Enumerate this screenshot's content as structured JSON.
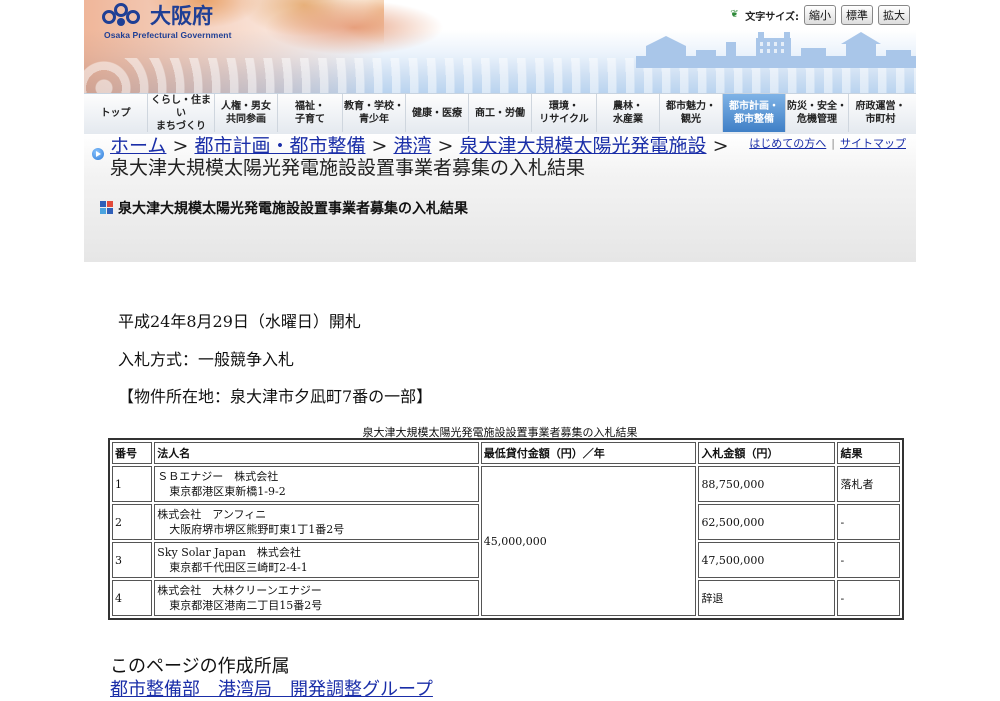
{
  "header": {
    "logo_jp": "大阪府",
    "logo_en": "Osaka Prefectural Government",
    "text_size_label": "文字サイズ:",
    "text_size_buttons": [
      "縮小",
      "標準",
      "拡大"
    ]
  },
  "nav": {
    "items": [
      {
        "label": "トップ",
        "active": false
      },
      {
        "label": "くらし・住まい\nまちづくり",
        "active": false
      },
      {
        "label": "人権・男女\n共同参画",
        "active": false
      },
      {
        "label": "福祉・\n子育て",
        "active": false
      },
      {
        "label": "教育・学校・\n青少年",
        "active": false
      },
      {
        "label": "健康・医療",
        "active": false
      },
      {
        "label": "商工・労働",
        "active": false
      },
      {
        "label": "環境・\nリサイクル",
        "active": false
      },
      {
        "label": "農林・\n水産業",
        "active": false
      },
      {
        "label": "都市魅力・\n観光",
        "active": false
      },
      {
        "label": "都市計画・\n都市整備",
        "active": true
      },
      {
        "label": "防災・安全・\n危機管理",
        "active": false
      },
      {
        "label": "府政運営・\n市町村",
        "active": false
      }
    ]
  },
  "breadcrumb": {
    "links": [
      "ホーム",
      "都市計画・都市整備",
      "港湾",
      "泉大津大規模太陽光発電施設"
    ],
    "separator": ">",
    "current": "泉大津大規模太陽光発電施設設置事業者募集の入札結果"
  },
  "help_links": {
    "beginner": "はじめての方へ",
    "sitemap": "サイトマップ"
  },
  "page_title": "泉大津大規模太陽光発電施設設置事業者募集の入札結果",
  "info": {
    "opening_date": "平成24年8月29日（水曜日）開札",
    "bid_method": "入札方式：一般競争入札",
    "location": "【物件所在地：泉大津市夕凪町7番の一部】"
  },
  "table": {
    "caption": "泉大津大規模太陽光発電施設設置事業者募集の入札結果",
    "headers": [
      "番号",
      "法人名",
      "最低貸付金額（円）／年",
      "入札金額（円）",
      "結果"
    ],
    "min_amount": "45,000,000",
    "rows": [
      {
        "no": "1",
        "name": "ＳＢエナジー　株式会社",
        "address": "東京都港区東新橋1-9-2",
        "bid": "88,750,000",
        "result": "落札者"
      },
      {
        "no": "2",
        "name": "株式会社　アンフィニ",
        "address": "大阪府堺市堺区熊野町東1丁1番2号",
        "bid": "62,500,000",
        "result": "-"
      },
      {
        "no": "3",
        "name": "Sky Solar Japan　株式会社",
        "address": "東京都千代田区三崎町2-4-1",
        "bid": "47,500,000",
        "result": "-"
      },
      {
        "no": "4",
        "name": "株式会社　大林クリーンエナジー",
        "address": "東京都港区港南二丁目15番2号",
        "bid": "辞退",
        "result": "-"
      }
    ]
  },
  "footer": {
    "heading": "このページの作成所属",
    "department": "都市整備部　港湾局　開発調整グループ"
  }
}
